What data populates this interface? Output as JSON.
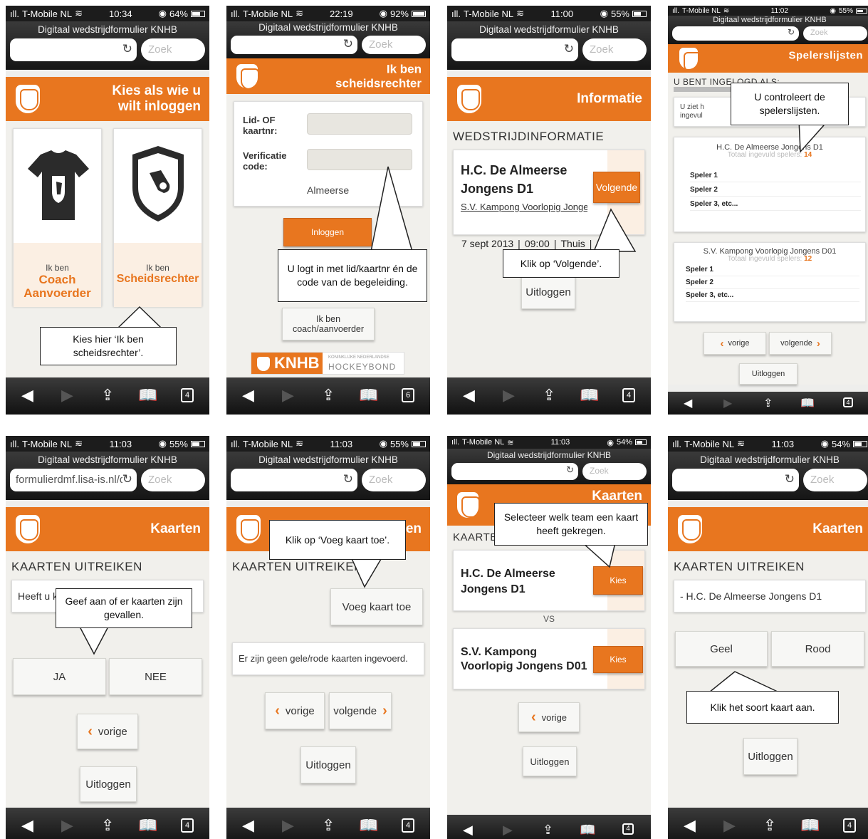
{
  "browser": {
    "page_title": "Digitaal wedstrijdformulier KNHB",
    "search_placeholder": "Zoek",
    "reload_icon": "reload-icon"
  },
  "screens": [
    {
      "status": {
        "carrier": "T-Mobile NL",
        "time": "10:34",
        "battery": "64%"
      },
      "header_line1": "Kies als wie u",
      "header_line2": "wilt inloggen",
      "coach_small": "Ik ben",
      "coach_big1": "Coach",
      "coach_big2": "Aanvoerder",
      "ref_small": "Ik ben",
      "ref_big": "Scheidsrechter",
      "hint": "Kies hier ‘Ik ben scheidsrechter’.",
      "tabs_count": "4"
    },
    {
      "status": {
        "carrier": "T-Mobile NL",
        "time": "22:19",
        "battery": "92%"
      },
      "header_line1": "Ik ben",
      "header_line2": "scheidsrechter",
      "lid_label": "Lid- OF kaartnr:",
      "verif_label": "Verificatie code:",
      "club_text": "Almeerse",
      "login_button": "Inloggen",
      "coach_button": "Ik ben coach/aanvoerder",
      "knhb_logo": "KNHB",
      "knhb_sub1": "KONINKLIJKE NEDERLANDSE",
      "knhb_sub2": "HOCKEYBOND",
      "hint": "U logt in met lid/kaartnr én de code van de begeleiding.",
      "tabs_count": "6"
    },
    {
      "status": {
        "carrier": "T-Mobile NL",
        "time": "11:00",
        "battery": "55%"
      },
      "header_title": "Informatie",
      "section_title": "WEDSTRIJDINFORMATIE",
      "team1": "H.C. De Almeerse",
      "team1_b": "Jongens D1",
      "team2": "S.V. Kampong Voorlopig Jongens",
      "date": "7 sept 2013",
      "time_val": "09:00",
      "location": "Thuis",
      "next_button": "Volgende",
      "logout_button": "Uitloggen",
      "hint": "Klik op ‘Volgende’.",
      "tabs_count": "4"
    },
    {
      "status": {
        "carrier": "T-Mobile NL",
        "time": "11:02",
        "battery": "55%"
      },
      "header_title": "Spelerslijsten",
      "logged_in": "U BENT INGELOGD ALS:",
      "intro": "U ziet h",
      "intro2": "ingevul",
      "team1_title": "H.C. De Almeerse Jongens D1",
      "team1_total_label": "Totaal ingevuld spelers:",
      "team1_total": "14",
      "team1_players": [
        "Speler 1",
        "Speler 2",
        "Speler 3, etc..."
      ],
      "team2_title": "S.V. Kampong Voorlopig Jongens D01",
      "team2_total_label": "Totaal ingevuld spelers:",
      "team2_total": "12",
      "team2_players": [
        "Speler 1",
        "Speler 2",
        "Speler 3, etc..."
      ],
      "prev_button": "vorige",
      "next_button": "volgende",
      "logout_button": "Uitloggen",
      "hint": "U controleert de spelerslijsten.",
      "tabs_count": "4"
    },
    {
      "status": {
        "carrier": "T-Mobile NL",
        "time": "11:03",
        "battery": "55%"
      },
      "url": "formulierdmf.lisa-is.nl/d",
      "header_title": "Kaarten",
      "section_title": "KAARTEN UITREIKEN",
      "question": "Heeft u ka",
      "yes_button": "JA",
      "no_button": "NEE",
      "prev_button": "vorige",
      "logout_button": "Uitloggen",
      "hint": "Geef aan of er kaarten zijn gevallen.",
      "tabs_count": "4"
    },
    {
      "status": {
        "carrier": "T-Mobile NL",
        "time": "11:03",
        "battery": "55%"
      },
      "header_title": "Kaarten",
      "section_title": "KAARTEN UITREIKEN",
      "add_button": "Voeg kaart toe",
      "no_cards": "Er zijn geen gele/rode kaarten ingevoerd.",
      "prev_button": "vorige",
      "next_button": "volgende",
      "logout_button": "Uitloggen",
      "hint": "Klik op ‘Voeg kaart toe’.",
      "tabs_count": "4"
    },
    {
      "status": {
        "carrier": "T-Mobile NL",
        "time": "11:03",
        "battery": "54%"
      },
      "header_title": "Kaarten",
      "section_title": "KAARTE",
      "team1": "H.C. De Almeerse",
      "team1_b": "Jongens D1",
      "vs": "VS",
      "team2": "S.V. Kampong",
      "team2_b": "Voorlopig Jongens D01",
      "choose_button": "Kies",
      "prev_button": "vorige",
      "logout_button": "Uitloggen",
      "hint": "Selecteer welk team een kaart heeft gekregen.",
      "tabs_count": "4"
    },
    {
      "status": {
        "carrier": "T-Mobile NL",
        "time": "11:03",
        "battery": "54%"
      },
      "header_title": "Kaarten",
      "section_title": "KAARTEN UITREIKEN",
      "team_selected": "- H.C. De Almeerse Jongens D1",
      "yellow_button": "Geel",
      "red_button": "Rood",
      "logout_button": "Uitloggen",
      "hint": "Klik het soort kaart aan.",
      "tabs_count": "4"
    }
  ],
  "colors": {
    "accent": "#e8761f",
    "toolbar": "#1c1c1c",
    "background": "#f1f0ec"
  }
}
